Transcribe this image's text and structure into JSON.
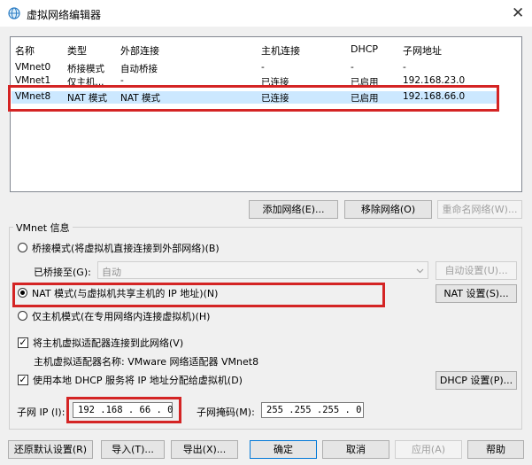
{
  "window": {
    "title": "虚拟网络编辑器",
    "close_glyph": "✕"
  },
  "network_table": {
    "headers": [
      "名称",
      "类型",
      "外部连接",
      "主机连接",
      "DHCP",
      "子网地址"
    ],
    "rows": [
      [
        "VMnet0",
        "桥接模式",
        "自动桥接",
        "-",
        "-",
        "-"
      ],
      [
        "VMnet1",
        "仅主机...",
        "-",
        "已连接",
        "已启用",
        "192.168.23.0"
      ],
      [
        "VMnet8",
        "NAT 模式",
        "NAT 模式",
        "已连接",
        "已启用",
        "192.168.66.0"
      ]
    ],
    "selected_row": "VMnet8"
  },
  "network_buttons": {
    "add": "添加网络(E)...",
    "remove": "移除网络(O)",
    "rename": "重命名网络(W)..."
  },
  "vmnet_info": {
    "title": "VMnet 信息",
    "bridged_mode": "桥接模式(将虚拟机直接连接到外部网络)(B)",
    "bridged_to_label": "已桥接至(G):",
    "bridged_to_value": "自动",
    "auto_settings": "自动设置(U)...",
    "nat_mode": "NAT 模式(与虚拟机共享主机的 IP 地址)(N)",
    "nat_settings": "NAT 设置(S)...",
    "host_only_mode": "仅主机模式(在专用网络内连接虚拟机)(H)",
    "selected_mode": "nat",
    "connect_adapter": "将主机虚拟适配器连接到此网络(V)",
    "connect_adapter_checked": true,
    "adapter_name": "主机虚拟适配器名称: VMware 网络适配器 VMnet8",
    "use_dhcp": "使用本地 DHCP 服务将 IP 地址分配给虚拟机(D)",
    "use_dhcp_checked": true,
    "dhcp_settings": "DHCP 设置(P)...",
    "check_glyph": "✓",
    "subnet_ip_label": "子网 IP (I):",
    "subnet_ip": "192 .168 . 66 . 0",
    "subnet_mask_label": "子网掩码(M):",
    "subnet_mask": "255 .255 .255 . 0"
  },
  "footer_buttons": {
    "restore": "还原默认设置(R)",
    "import": "导入(T)...",
    "export": "导出(X)...",
    "ok": "确定",
    "cancel": "取消",
    "apply": "应用(A)",
    "help": "帮助"
  },
  "colors": {
    "highlight": "#d42424",
    "accent": "#0078d7"
  }
}
